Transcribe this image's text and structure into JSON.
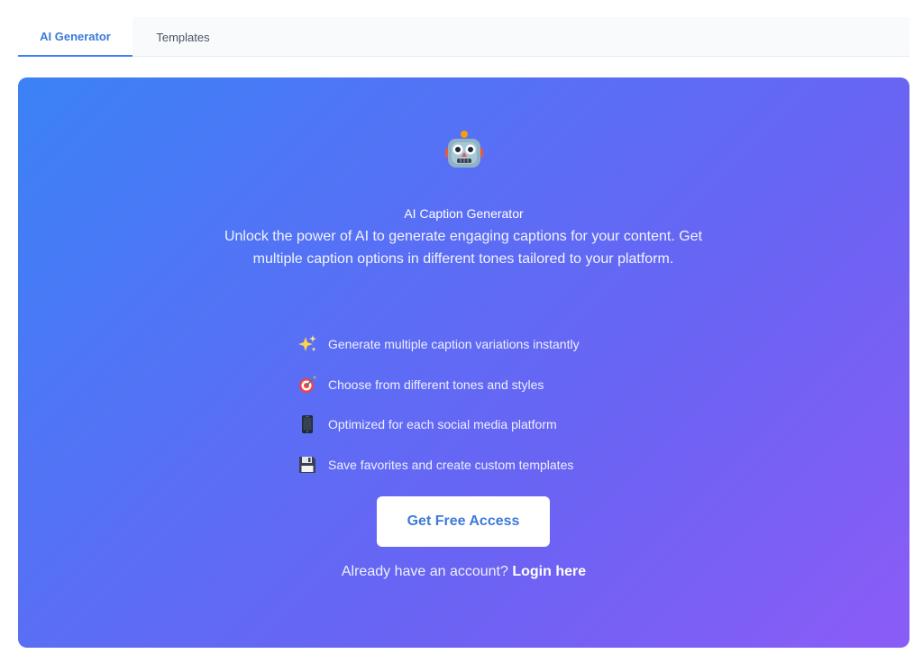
{
  "tabs": [
    {
      "label": "AI Generator",
      "active": true
    },
    {
      "label": "Templates",
      "active": false
    }
  ],
  "hero": {
    "icon": "robot-icon",
    "title": "AI Caption Generator",
    "description": "Unlock the power of AI to generate engaging captions for your content. Get multiple caption options in different tones tailored to your platform.",
    "features": [
      {
        "icon": "sparkles-icon",
        "text": "Generate multiple caption variations instantly"
      },
      {
        "icon": "target-icon",
        "text": "Choose from different tones and styles"
      },
      {
        "icon": "mobile-phone-icon",
        "text": "Optimized for each social media platform"
      },
      {
        "icon": "floppy-disk-icon",
        "text": "Save favorites and create custom templates"
      }
    ],
    "cta_label": "Get Free Access",
    "login_prompt": "Already have an account?",
    "login_link": "Login here"
  },
  "colors": {
    "accent": "#3b82f6",
    "gradient_start": "#3b82f6",
    "gradient_end": "#8b5cf6"
  }
}
